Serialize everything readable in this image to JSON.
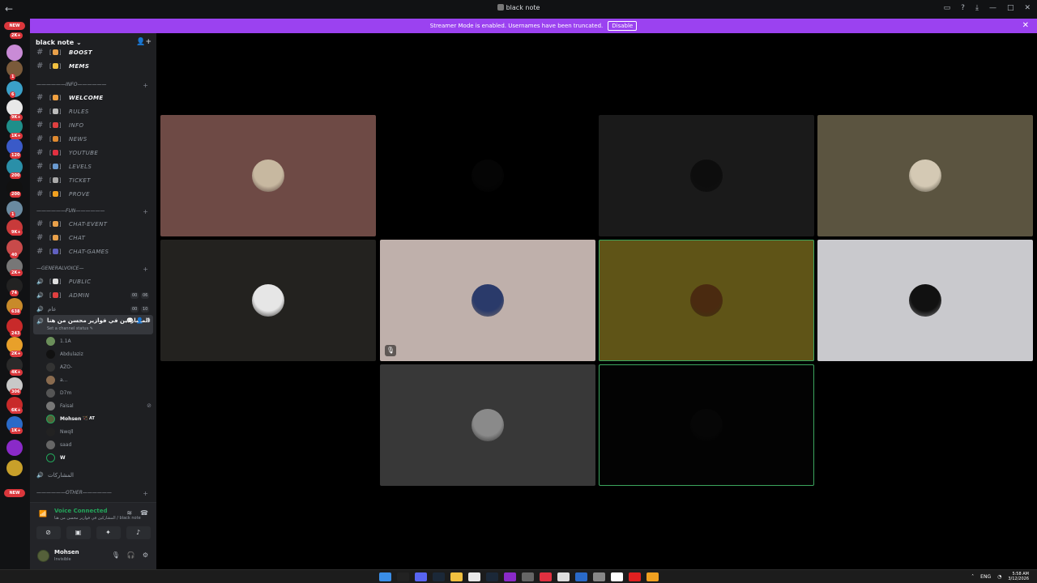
{
  "window": {
    "title": "black note",
    "back": "←",
    "controls": [
      "▭",
      "?",
      "⤓",
      "—",
      "□",
      "✕"
    ]
  },
  "banner": {
    "text": "Streamer Mode is enabled. Usernames have been truncated.",
    "button": "Disable",
    "close": "✕"
  },
  "rail": {
    "new_top": "NEW",
    "new_bottom": "NEW",
    "badges": [
      "2K+",
      "1",
      "6",
      "9K+",
      "1K+",
      "120",
      "200",
      "200",
      "1",
      "9K+",
      "40",
      "2K+",
      "74",
      "638",
      "243",
      "2K+",
      "4K+",
      "306",
      "6K+",
      "1K+"
    ]
  },
  "guild": {
    "name": "black note",
    "chevron": "⌄",
    "add_member_icon": "👤+"
  },
  "channels": {
    "top": [
      {
        "name": "BOOST",
        "emoji": "🎁"
      },
      {
        "name": "MEMS",
        "emoji": "😂"
      }
    ],
    "info_category": "——————INFO——————",
    "info": [
      {
        "name": "WELCOME",
        "emoji": "👋"
      },
      {
        "name": "RULES",
        "emoji": "📜"
      },
      {
        "name": "INFO",
        "emoji": "❓"
      },
      {
        "name": "NEWS",
        "emoji": "📰"
      },
      {
        "name": "YOUTUBE",
        "emoji": "🔴"
      },
      {
        "name": "LEVELS",
        "emoji": "📊"
      },
      {
        "name": "TICKET",
        "emoji": "🎫"
      },
      {
        "name": "PROVE",
        "emoji": "⚡"
      }
    ],
    "fun_category": "——————FUN——————",
    "fun": [
      {
        "name": "CHAT-EVENT",
        "emoji": "🎁"
      },
      {
        "name": "CHAT",
        "emoji": "🎁"
      },
      {
        "name": "CHAT-GAMES",
        "emoji": "🎮"
      }
    ],
    "voice_category": "—GENERALVOICE—",
    "voice": [
      {
        "name": "PUBLIC",
        "emoji": "⚪",
        "c1": "",
        "c2": ""
      },
      {
        "name": "ADMIN",
        "emoji": "⭕",
        "c1": "00",
        "c2": "06"
      },
      {
        "name": "عام",
        "emoji": "",
        "c1": "00",
        "c2": "10"
      }
    ],
    "active_voice": {
      "name": "المشاركين في فوازير محسن من هنا",
      "status": "Set a channel status ✎"
    },
    "members": [
      {
        "name": "1.1A",
        "color": "#6b8f5a"
      },
      {
        "name": "Abdulaziz",
        "color": "#111"
      },
      {
        "name": "AZO-",
        "color": "#333"
      },
      {
        "name": "a...",
        "color": "#8a6b4f"
      },
      {
        "name": "D7m",
        "color": "#555"
      },
      {
        "name": "Faisal",
        "color": "#777",
        "muted": true
      },
      {
        "name": "Mohsen",
        "color": "#55603a",
        "me": true,
        "tag": "🏹 AT"
      },
      {
        "name": "Nwqll",
        "color": "#222"
      },
      {
        "name": "saad",
        "color": "#666"
      },
      {
        "name": "W",
        "color": "#1e1f22",
        "me": true
      }
    ],
    "after_voice": "المشاركات",
    "other_category": "——————OTHER——————"
  },
  "voice_panel": {
    "status": "Voice Connected",
    "sub": "المشاركين في فوازير محسن من هنا / black note"
  },
  "user_panel": {
    "name": "Mohsen",
    "status": "Invisible"
  },
  "tiles": [
    {
      "bg": "#6e4a45",
      "av": "#c7b8a0",
      "speaking": false,
      "muted": false
    },
    {
      "bg": "#000000",
      "av": "#050505",
      "speaking": false,
      "muted": false
    },
    {
      "bg": "#1a1a1a",
      "av": "#0d0d0d",
      "speaking": false,
      "muted": false
    },
    {
      "bg": "#5b5440",
      "av": "#d4c9b4",
      "speaking": false,
      "muted": false
    },
    {
      "bg": "#23221f",
      "av": "#e6e6e6",
      "speaking": false,
      "muted": false
    },
    {
      "bg": "#bfb0ab",
      "av": "#2a3a6a",
      "speaking": false,
      "muted": true
    },
    {
      "bg": "#5f5417",
      "av": "#4a2a10",
      "speaking": true,
      "muted": false
    },
    {
      "bg": "#c9c9cd",
      "av": "#111111",
      "speaking": false,
      "muted": false
    },
    {
      "bg": "#383838",
      "av": "#8a8a8a",
      "speaking": false,
      "muted": false
    },
    {
      "bg": "#030303",
      "av": "#060606",
      "speaking": true,
      "muted": false
    }
  ],
  "taskbar": {
    "lang": "ENG",
    "time": "5:58 AM",
    "date": "3/12/2026"
  }
}
